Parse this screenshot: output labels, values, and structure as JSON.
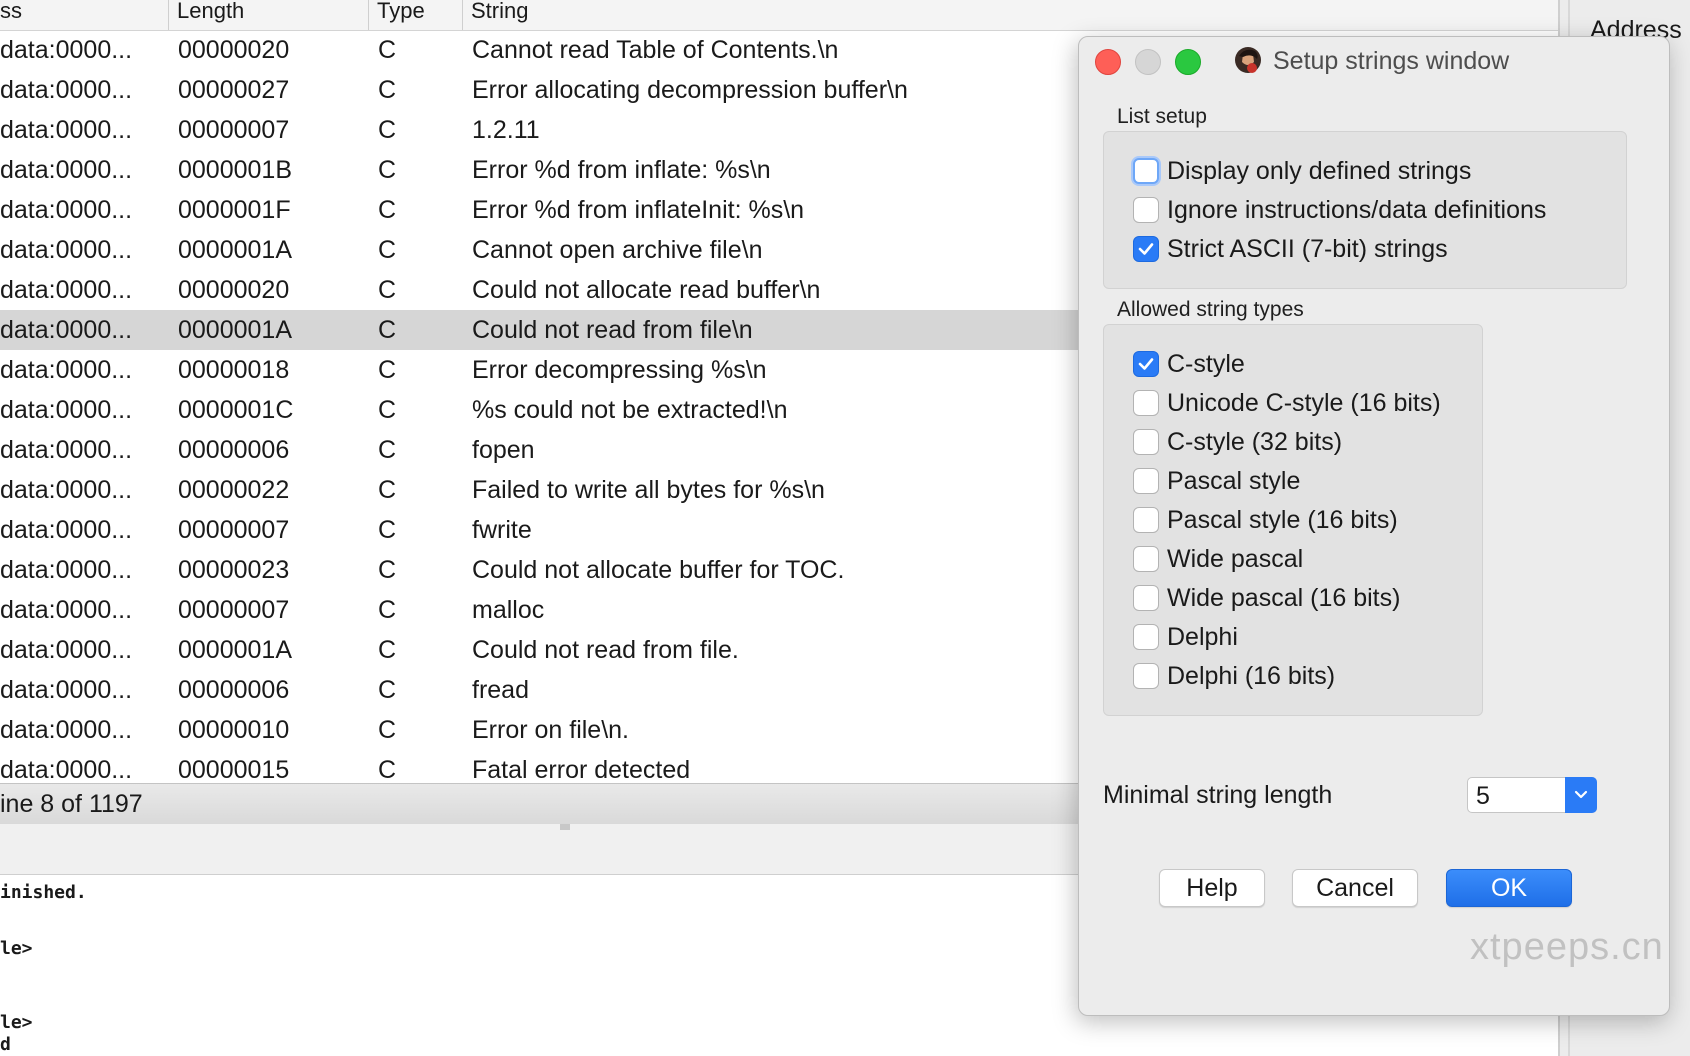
{
  "list": {
    "columns": [
      "ss",
      "Length",
      "Type",
      "String"
    ],
    "rows": [
      {
        "addr": "data:0000...",
        "len": "00000020",
        "type": "C",
        "str": "Cannot read Table of Contents.\\n"
      },
      {
        "addr": "data:0000...",
        "len": "00000027",
        "type": "C",
        "str": "Error allocating decompression buffer\\n"
      },
      {
        "addr": "data:0000...",
        "len": "00000007",
        "type": "C",
        "str": "1.2.11"
      },
      {
        "addr": "data:0000...",
        "len": "0000001B",
        "type": "C",
        "str": "Error %d from inflate: %s\\n"
      },
      {
        "addr": "data:0000...",
        "len": "0000001F",
        "type": "C",
        "str": "Error %d from inflateInit: %s\\n"
      },
      {
        "addr": "data:0000...",
        "len": "0000001A",
        "type": "C",
        "str": "Cannot open archive file\\n"
      },
      {
        "addr": "data:0000...",
        "len": "00000020",
        "type": "C",
        "str": "Could not allocate read buffer\\n"
      },
      {
        "addr": "data:0000...",
        "len": "0000001A",
        "type": "C",
        "str": "Could not read from file\\n"
      },
      {
        "addr": "data:0000...",
        "len": "00000018",
        "type": "C",
        "str": "Error decompressing %s\\n"
      },
      {
        "addr": "data:0000...",
        "len": "0000001C",
        "type": "C",
        "str": "%s could not be extracted!\\n"
      },
      {
        "addr": "data:0000...",
        "len": "00000006",
        "type": "C",
        "str": "fopen"
      },
      {
        "addr": "data:0000...",
        "len": "00000022",
        "type": "C",
        "str": "Failed to write all bytes for %s\\n"
      },
      {
        "addr": "data:0000...",
        "len": "00000007",
        "type": "C",
        "str": "fwrite"
      },
      {
        "addr": "data:0000...",
        "len": "00000023",
        "type": "C",
        "str": "Could not allocate buffer for TOC."
      },
      {
        "addr": "data:0000...",
        "len": "00000007",
        "type": "C",
        "str": "malloc"
      },
      {
        "addr": "data:0000...",
        "len": "0000001A",
        "type": "C",
        "str": "Could not read from file."
      },
      {
        "addr": "data:0000...",
        "len": "00000006",
        "type": "C",
        "str": "fread"
      },
      {
        "addr": "data:0000...",
        "len": "00000010",
        "type": "C",
        "str": "Error on file\\n."
      },
      {
        "addr": "data:0000...",
        "len": "00000015",
        "type": "C",
        "str": "Fatal error detected"
      }
    ],
    "selected_index": 7
  },
  "status": {
    "text": "ine 8 of 1197"
  },
  "output": {
    "lines": [
      "inished.",
      "le>",
      "le>",
      "d"
    ]
  },
  "right_panel": {
    "label": "Address"
  },
  "dialog": {
    "title": "Setup strings window",
    "list_setup": {
      "label": "List setup",
      "options": [
        {
          "label": "Display only defined strings",
          "checked": false,
          "focused": true
        },
        {
          "label": "Ignore instructions/data definitions",
          "checked": false,
          "focused": false
        },
        {
          "label": "Strict ASCII (7-bit) strings",
          "checked": true,
          "focused": false
        }
      ]
    },
    "allowed_types": {
      "label": "Allowed string types",
      "options": [
        {
          "label": "C-style",
          "checked": true
        },
        {
          "label": "Unicode C-style (16 bits)",
          "checked": false
        },
        {
          "label": "C-style (32 bits)",
          "checked": false
        },
        {
          "label": "Pascal style",
          "checked": false
        },
        {
          "label": "Pascal style (16 bits)",
          "checked": false
        },
        {
          "label": "Wide pascal",
          "checked": false
        },
        {
          "label": "Wide pascal (16 bits)",
          "checked": false
        },
        {
          "label": "Delphi",
          "checked": false
        },
        {
          "label": "Delphi (16 bits)",
          "checked": false
        }
      ]
    },
    "min_length": {
      "label": "Minimal string length",
      "value": "5"
    },
    "buttons": {
      "help": "Help",
      "cancel": "Cancel",
      "ok": "OK"
    }
  },
  "watermark": "xtpeeps.cn",
  "colors": {
    "accent": "#2a7bf6",
    "selected_row": "#d6d6d6",
    "close": "#fe5f57",
    "maximize": "#2ac840"
  }
}
